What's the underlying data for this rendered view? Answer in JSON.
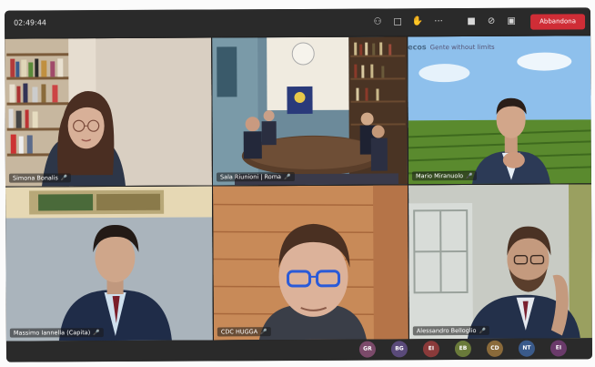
{
  "meeting": {
    "timer": "02:49:44",
    "leave_label": "Abbandona",
    "toolbar_icons": [
      "participants-icon",
      "chat-icon",
      "raise-hand-icon",
      "more-options-icon",
      "camera-icon",
      "microphone-muted-icon",
      "share-screen-icon"
    ]
  },
  "participants": [
    {
      "name": "Simona Bonalis"
    },
    {
      "name": "Sala Riunioni | Roma"
    },
    {
      "name": "Mario Miranuolo"
    },
    {
      "name": "Massimo Iannella (Capita)"
    },
    {
      "name": "CDC HUGGA"
    },
    {
      "name": "Alessandro Belloglio"
    }
  ],
  "brand": {
    "logo": "ecos",
    "tagline": "Gente without limits"
  },
  "avatars": [
    {
      "initials": "GR",
      "color": "#7b4a6a"
    },
    {
      "initials": "BG",
      "color": "#5a4a7a"
    },
    {
      "initials": "EI",
      "color": "#8a3a3a"
    },
    {
      "initials": "EB",
      "color": "#6a7a3a"
    },
    {
      "initials": "CD",
      "color": "#8a6a3a"
    },
    {
      "initials": "NT",
      "color": "#3a5a8a"
    },
    {
      "initials": "EI",
      "color": "#6a3a6a"
    }
  ]
}
